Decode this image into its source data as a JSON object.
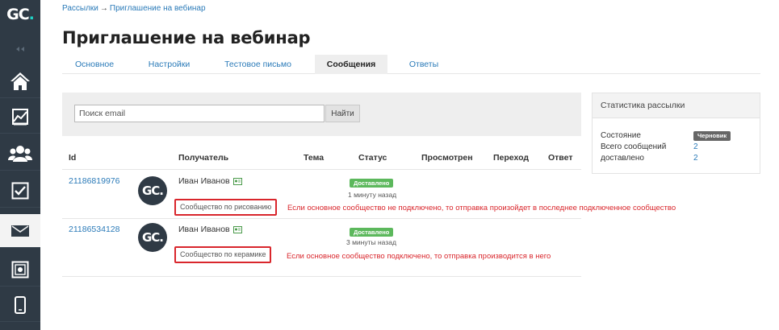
{
  "sidebar": {
    "logo_main": "GC",
    "logo_dot": ".",
    "items": [
      {
        "icon": "home-icon"
      },
      {
        "icon": "chart-icon"
      },
      {
        "icon": "users-icon"
      },
      {
        "icon": "checkbox-icon"
      },
      {
        "icon": "mail-icon",
        "active": true
      },
      {
        "icon": "safe-icon"
      },
      {
        "icon": "mobile-icon"
      }
    ]
  },
  "breadcrumb": {
    "parent": "Рассылки",
    "separator": "→",
    "current": "Приглашение на вебинар"
  },
  "page": {
    "title": "Приглашение на вебинар"
  },
  "tabs": [
    {
      "label": "Основное"
    },
    {
      "label": "Настройки"
    },
    {
      "label": "Тестовое письмо"
    },
    {
      "label": "Сообщения",
      "active": true
    },
    {
      "label": "Ответы"
    }
  ],
  "search": {
    "placeholder": "Поиск email",
    "button_label": "Найти"
  },
  "table": {
    "headers": {
      "id": "Id",
      "recipient": "Получатель",
      "subject": "Тема",
      "status": "Статус",
      "viewed": "Просмотрен",
      "click": "Переход",
      "reply": "Ответ"
    },
    "rows": [
      {
        "id": "21186819976",
        "avatar": "GC.",
        "name": "Иван Иванов",
        "community": "Сообщество по рисованию",
        "status": "Доставлено",
        "time": "1 минуту назад",
        "note": "Если основное сообщество не подключено, то отправка произойдет в последнее подключенное сообщество"
      },
      {
        "id": "21186534128",
        "avatar": "GC.",
        "name": "Иван Иванов",
        "community": "Сообщество по керамике",
        "status": "Доставлено",
        "time": "3 минуты назад",
        "note": "Если основное сообщество подключено, то отправка производится в него"
      }
    ]
  },
  "stats": {
    "title": "Статистика рассылки",
    "state_label": "Состояние",
    "state_value": "Черновик",
    "total_label": "Всего сообщений",
    "total_value": "2",
    "delivered_label": "доставлено",
    "delivered_value": "2"
  },
  "colors": {
    "sidebar_bg": "#2f3a45",
    "accent_link": "#2a7ab8",
    "success": "#5cb85c",
    "annotation_red": "#d9262c",
    "logo_dot": "#1fd3c6"
  }
}
